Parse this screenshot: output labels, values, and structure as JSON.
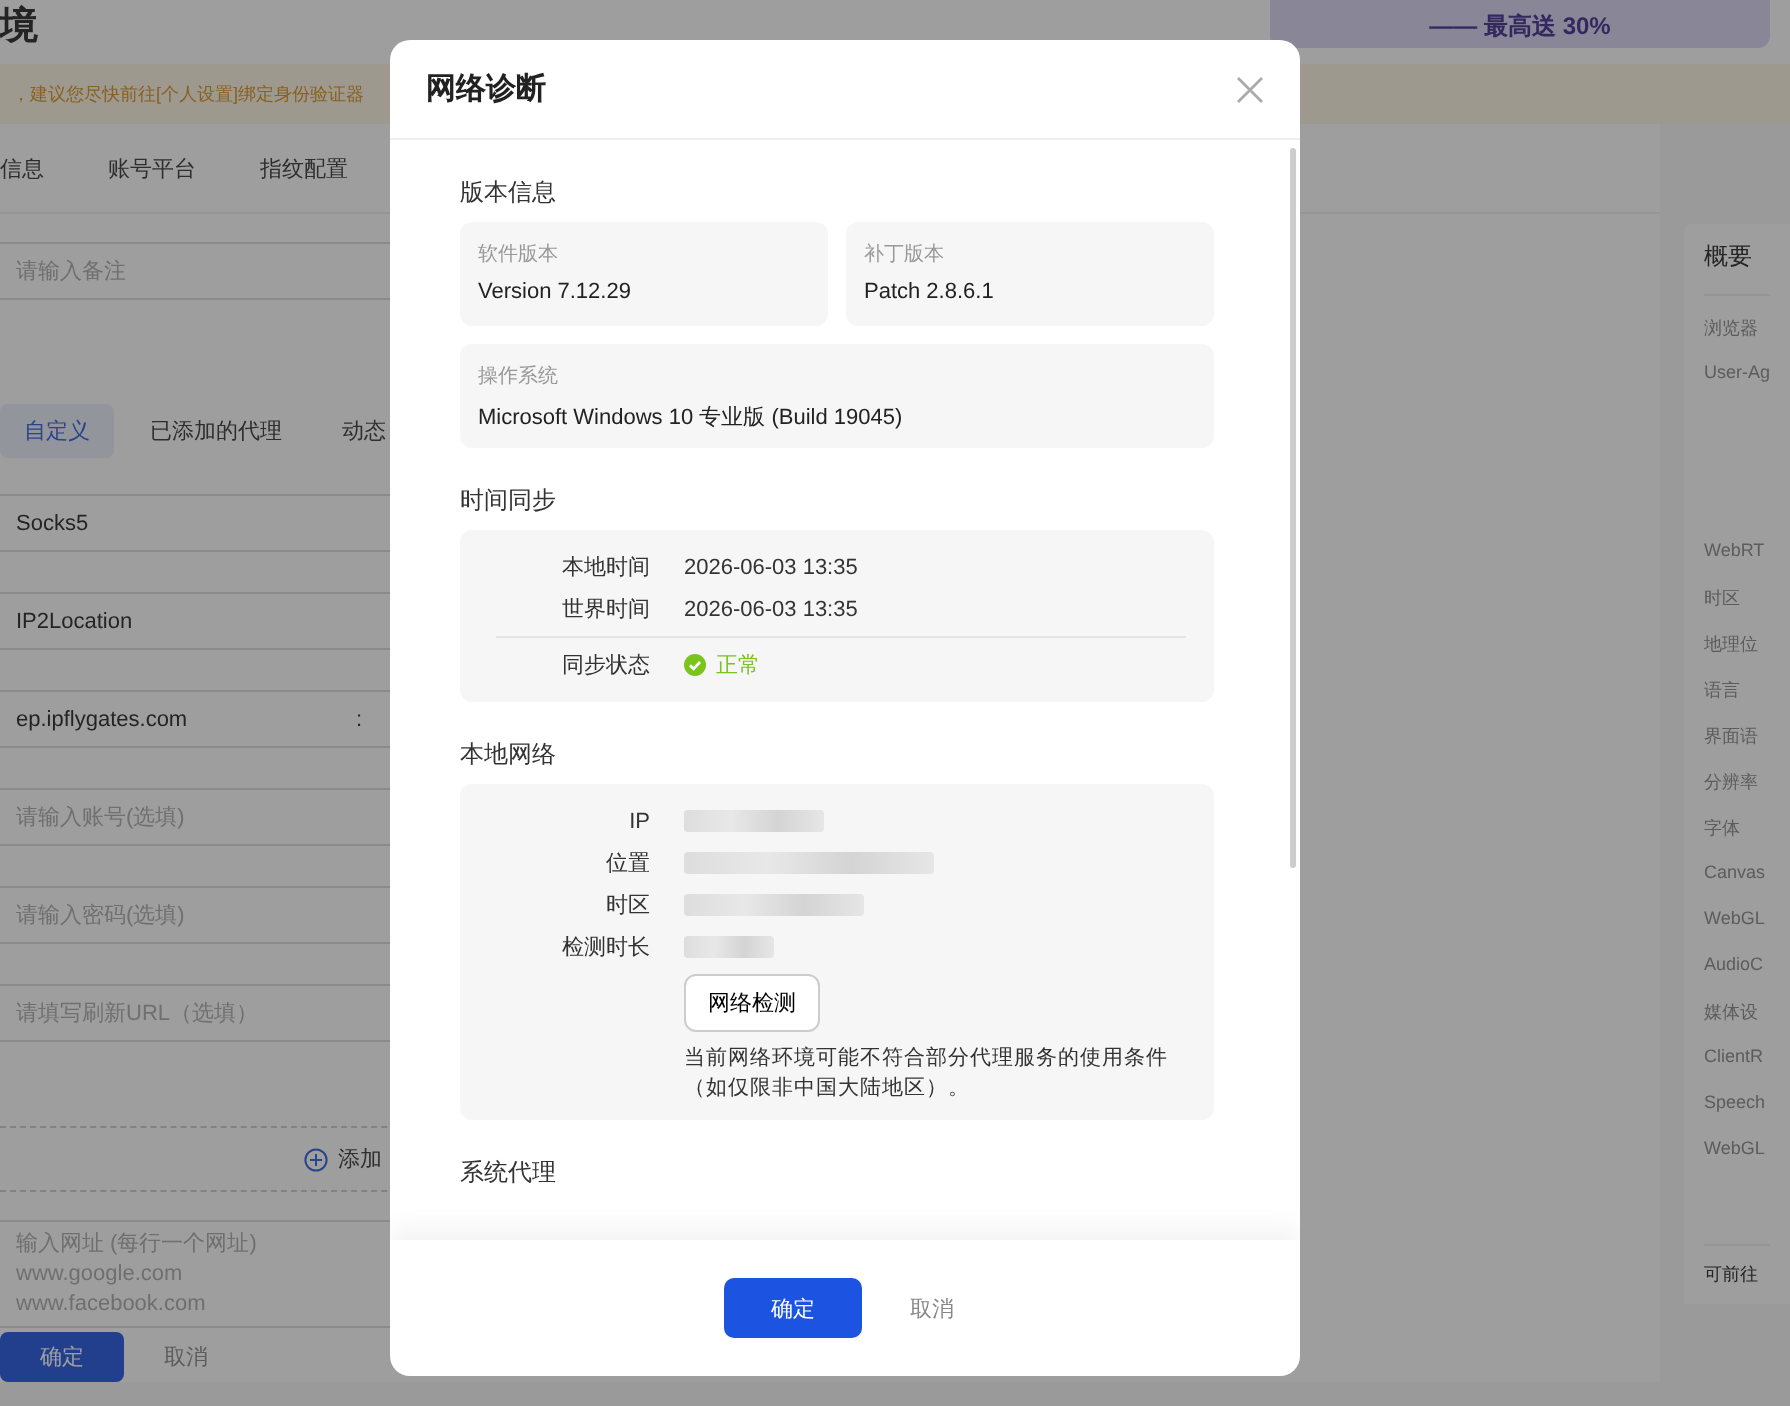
{
  "page": {
    "title_fragment": "境",
    "warning": "，建议您尽快前往[个人设置]绑定身份验证器",
    "banner": "—— 最高送 30%",
    "tabs": [
      {
        "label": "信息",
        "selected": false
      },
      {
        "label": "账号平台",
        "selected": false
      },
      {
        "label": "指纹配置",
        "selected": false
      }
    ],
    "note_field": {
      "placeholder": "请输入备注"
    },
    "proxy_tabs": [
      {
        "label": "自定义",
        "selected": true
      },
      {
        "label": "已添加的代理",
        "selected": false
      },
      {
        "label": "动态",
        "selected": false
      }
    ],
    "proxy_fields": [
      {
        "value": "Socks5"
      },
      {
        "value": "IP2Location"
      },
      {
        "value": "ep.ipflygates.com",
        "suffix": ":"
      },
      {
        "placeholder": "请输入账号(选填)"
      },
      {
        "placeholder": "请输入密码(选填)"
      },
      {
        "placeholder": "请填写刷新URL（选填）"
      }
    ],
    "add_label": "添加",
    "url_field": {
      "placeholder": "输入网址 (每行一个网址)\nwww.google.com\nwww.facebook.com"
    },
    "buttons": [
      "确定",
      "取消"
    ],
    "summary": {
      "title": "概要",
      "items": [
        {
          "label": "浏览器",
          "tall": false
        },
        {
          "label": "User-Ag",
          "tall": true
        },
        {
          "label": "WebRT",
          "tall": false
        },
        {
          "label": "时区",
          "tall": false
        },
        {
          "label": "地理位",
          "tall": false
        },
        {
          "label": "语言",
          "tall": false
        },
        {
          "label": "界面语",
          "tall": false
        },
        {
          "label": "分辨率",
          "tall": false
        },
        {
          "label": "字体",
          "tall": false
        },
        {
          "label": "Canvas",
          "tall": false
        },
        {
          "label": "WebGL",
          "tall": false
        },
        {
          "label": "AudioC",
          "tall": false
        },
        {
          "label": "媒体设",
          "tall": false
        },
        {
          "label": "ClientR",
          "tall": false
        },
        {
          "label": "Speech",
          "tall": false
        },
        {
          "label": "WebGL",
          "tall": false
        }
      ],
      "footer": "可前往"
    }
  },
  "dialog": {
    "title": "网络诊断",
    "version": {
      "heading": "版本信息",
      "cards": [
        {
          "label": "软件版本",
          "value": "Version 7.12.29"
        },
        {
          "label": "补丁版本",
          "value": "Patch 2.8.6.1"
        },
        {
          "label": "操作系统",
          "value": "Microsoft Windows 10 专业版 (Build 19045)"
        }
      ]
    },
    "time_sync": {
      "heading": "时间同步",
      "rows": [
        {
          "label": "本地时间",
          "value": "2026-06-03 13:35"
        },
        {
          "label": "世界时间",
          "value": "2026-06-03 13:35"
        }
      ],
      "status_label": "同步状态",
      "status": "正常"
    },
    "network": {
      "heading": "本地网络",
      "rows": [
        {
          "label": "IP"
        },
        {
          "label": "位置"
        },
        {
          "label": "时区"
        },
        {
          "label": "检测时长"
        }
      ],
      "button": "网络检测",
      "note": "当前网络环境可能不符合部分代理服务的使用条件（如仅限非中国大陆地区）。"
    },
    "next_heading": "系统代理",
    "buttons": [
      "确定",
      "取消"
    ]
  }
}
